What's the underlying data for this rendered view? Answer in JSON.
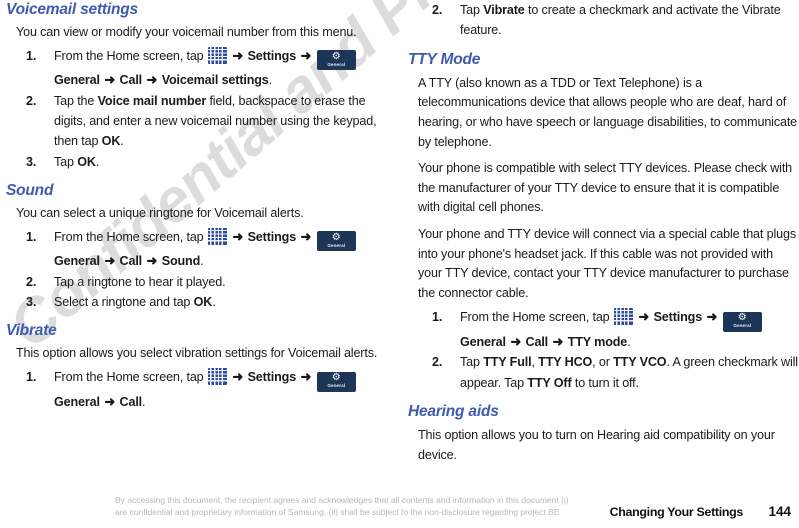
{
  "document": {
    "watermark": "Confidential and Proprietary Draft",
    "footer": {
      "disclaimer_line1": "By accessing this document, the recipient agrees and acknowledges that all contents and information in this document (i)",
      "disclaimer_line2": "are confidential and proprietary information of Samsung, (ii) shall be subject to the non-disclosure regarding project BE",
      "chapter": "Changing Your Settings",
      "page_number": "144"
    },
    "colors": {
      "heading": "#3f5bad",
      "body_text": "#1b1b1b",
      "apps_icon": "#2b4a9b",
      "general_icon": "#1d3557",
      "footer_disclaimer": "#b9b9b9"
    },
    "icons": {
      "apps_grid": "apps-grid-icon",
      "general_settings": "general-settings-icon",
      "general_label": "General",
      "gear_glyph": "⚙",
      "arrow_glyph": "➜"
    }
  },
  "left_column": {
    "sections": [
      {
        "heading": "Voicemail settings",
        "intro": "You can view or modify your voicemail number from this menu.",
        "steps": [
          {
            "num": "1.",
            "parts": [
              {
                "type": "text",
                "value": "From the Home screen, tap "
              },
              {
                "type": "icon",
                "value": "apps-grid-icon"
              },
              {
                "type": "arrow"
              },
              {
                "type": "bold",
                "value": "Settings"
              },
              {
                "type": "arrow"
              },
              {
                "type": "icon",
                "value": "general-settings-icon"
              },
              {
                "type": "bold",
                "value": "General"
              },
              {
                "type": "arrow"
              },
              {
                "type": "bold",
                "value": "Call"
              },
              {
                "type": "arrow"
              },
              {
                "type": "bold",
                "value": "Voicemail settings"
              },
              {
                "type": "text",
                "value": "."
              }
            ]
          },
          {
            "num": "2.",
            "parts": [
              {
                "type": "text",
                "value": "Tap the "
              },
              {
                "type": "bold",
                "value": "Voice mail number"
              },
              {
                "type": "text",
                "value": " field, backspace to erase the digits, and enter a new voicemail number using the keypad, then tap "
              },
              {
                "type": "bold",
                "value": "OK"
              },
              {
                "type": "text",
                "value": "."
              }
            ]
          },
          {
            "num": "3.",
            "parts": [
              {
                "type": "text",
                "value": "Tap "
              },
              {
                "type": "bold",
                "value": "OK"
              },
              {
                "type": "text",
                "value": "."
              }
            ]
          }
        ]
      },
      {
        "heading": "Sound",
        "intro": "You can select a unique ringtone for Voicemail alerts.",
        "steps": [
          {
            "num": "1.",
            "parts": [
              {
                "type": "text",
                "value": "From the Home screen, tap "
              },
              {
                "type": "icon",
                "value": "apps-grid-icon"
              },
              {
                "type": "arrow"
              },
              {
                "type": "bold",
                "value": "Settings"
              },
              {
                "type": "arrow"
              },
              {
                "type": "icon",
                "value": "general-settings-icon"
              },
              {
                "type": "bold",
                "value": "General"
              },
              {
                "type": "arrow"
              },
              {
                "type": "bold",
                "value": "Call"
              },
              {
                "type": "arrow"
              },
              {
                "type": "bold",
                "value": "Sound"
              },
              {
                "type": "text",
                "value": "."
              }
            ]
          },
          {
            "num": "2.",
            "parts": [
              {
                "type": "text",
                "value": "Tap a ringtone to hear it played."
              }
            ]
          },
          {
            "num": "3.",
            "parts": [
              {
                "type": "text",
                "value": " Select a ringtone and tap "
              },
              {
                "type": "bold",
                "value": "OK"
              },
              {
                "type": "text",
                "value": "."
              }
            ]
          }
        ]
      },
      {
        "heading": "Vibrate",
        "intro": "This option allows you select vibration settings for Voicemail alerts.",
        "steps": [
          {
            "num": "1.",
            "parts": [
              {
                "type": "text",
                "value": "From the Home screen, tap "
              },
              {
                "type": "icon",
                "value": "apps-grid-icon"
              },
              {
                "type": "arrow"
              },
              {
                "type": "bold",
                "value": "Settings"
              },
              {
                "type": "arrow"
              },
              {
                "type": "icon",
                "value": "general-settings-icon"
              },
              {
                "type": "bold",
                "value": "General"
              },
              {
                "type": "arrow"
              },
              {
                "type": "bold",
                "value": "Call"
              },
              {
                "type": "text",
                "value": "."
              }
            ]
          }
        ]
      }
    ]
  },
  "right_column": {
    "continued_step": {
      "num": "2.",
      "parts": [
        {
          "type": "text",
          "value": "Tap "
        },
        {
          "type": "bold",
          "value": "Vibrate"
        },
        {
          "type": "text",
          "value": " to create a checkmark and activate the Vibrate feature."
        }
      ]
    },
    "sections": [
      {
        "heading": "TTY Mode",
        "paragraphs": [
          "A TTY (also known as a TDD or Text Telephone) is a telecommunications device that allows people who are deaf, hard of hearing, or who have speech or language disabilities, to communicate by telephone.",
          "Your phone is compatible with select TTY devices. Please check with the manufacturer of your TTY device to ensure that it is compatible with digital cell phones.",
          "Your phone and TTY device will connect via a special cable that plugs into your phone's headset jack. If this cable was not provided with your TTY device, contact your TTY device manufacturer to purchase the connector cable."
        ],
        "steps": [
          {
            "num": "1.",
            "parts": [
              {
                "type": "text",
                "value": "From the Home screen, tap "
              },
              {
                "type": "icon",
                "value": "apps-grid-icon"
              },
              {
                "type": "arrow"
              },
              {
                "type": "bold",
                "value": "Settings"
              },
              {
                "type": "arrow"
              },
              {
                "type": "icon",
                "value": "general-settings-icon"
              },
              {
                "type": "bold",
                "value": "General"
              },
              {
                "type": "arrow"
              },
              {
                "type": "bold",
                "value": "Call"
              },
              {
                "type": "arrow"
              },
              {
                "type": "bold",
                "value": "TTY mode"
              },
              {
                "type": "text",
                "value": "."
              }
            ]
          },
          {
            "num": "2.",
            "parts": [
              {
                "type": "text",
                "value": "Tap "
              },
              {
                "type": "bold",
                "value": "TTY Full"
              },
              {
                "type": "text",
                "value": ", "
              },
              {
                "type": "bold",
                "value": "TTY HCO"
              },
              {
                "type": "text",
                "value": ", or "
              },
              {
                "type": "bold",
                "value": "TTY VCO"
              },
              {
                "type": "text",
                "value": ". A green checkmark will appear. Tap "
              },
              {
                "type": "bold",
                "value": "TTY Off"
              },
              {
                "type": "text",
                "value": " to turn it off."
              }
            ]
          }
        ]
      },
      {
        "heading": "Hearing aids",
        "paragraphs": [
          "This option allows you to turn on Hearing aid compatibility on your device."
        ],
        "steps": []
      }
    ]
  }
}
